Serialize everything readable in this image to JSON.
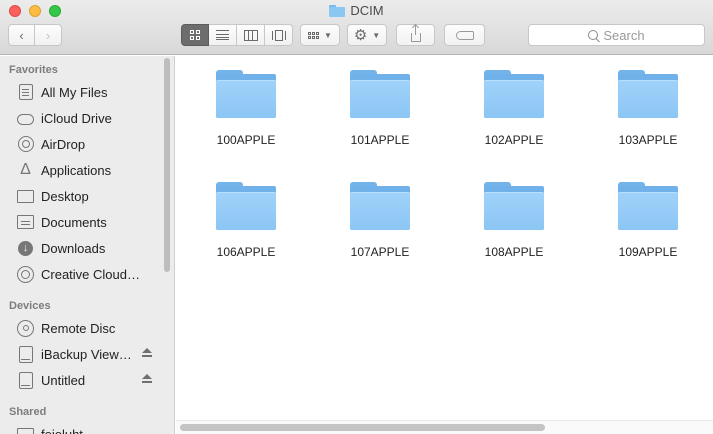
{
  "window": {
    "title": "DCIM"
  },
  "toolbar": {
    "search_placeholder": "Search"
  },
  "sidebar": {
    "favorites_header": "Favorites",
    "favorites": [
      {
        "label": "All My Files",
        "icon": "all-files-icon"
      },
      {
        "label": "iCloud Drive",
        "icon": "cloud-icon"
      },
      {
        "label": "AirDrop",
        "icon": "airdrop-icon"
      },
      {
        "label": "Applications",
        "icon": "applications-icon"
      },
      {
        "label": "Desktop",
        "icon": "desktop-icon"
      },
      {
        "label": "Documents",
        "icon": "documents-icon"
      },
      {
        "label": "Downloads",
        "icon": "downloads-icon"
      },
      {
        "label": "Creative Cloud…",
        "icon": "creative-cloud-icon"
      }
    ],
    "devices_header": "Devices",
    "devices": [
      {
        "label": "Remote Disc",
        "icon": "disc-icon"
      },
      {
        "label": "iBackup View…",
        "icon": "drive-icon",
        "eject": true
      },
      {
        "label": "Untitled",
        "icon": "drive-icon",
        "eject": true
      }
    ],
    "shared_header": "Shared",
    "shared": [
      {
        "label": "feioluht"
      }
    ]
  },
  "folders": [
    "100APPLE",
    "101APPLE",
    "102APPLE",
    "103APPLE",
    "106APPLE",
    "107APPLE",
    "108APPLE",
    "109APPLE"
  ],
  "colors": {
    "folder": "#8cc6f4",
    "sidebar_bg": "#ececec"
  }
}
